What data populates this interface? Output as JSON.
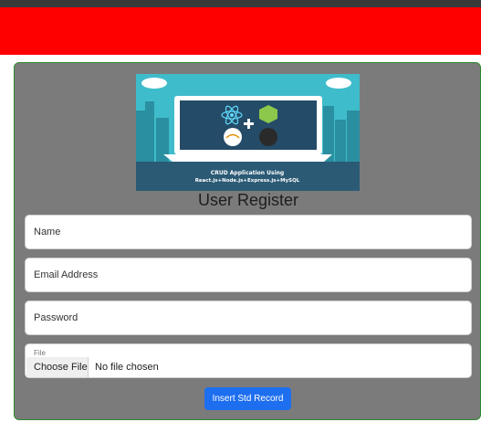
{
  "form": {
    "title": "User Register",
    "banner_caption_line1": "CRUD Application Using",
    "banner_caption_line2": "React.js+Node.js+Express.js+MySQL",
    "banner_logos": [
      "react-logo",
      "nodejs-logo",
      "mysql-logo",
      "express-logo"
    ],
    "name_placeholder": "Name",
    "email_placeholder": "Email Address",
    "password_placeholder": "Password",
    "file_label": "File",
    "file_button": "Choose File",
    "file_status": "No file chosen",
    "submit_label": "Insert Std Record"
  },
  "colors": {
    "header_red": "#ff0000",
    "card_bg": "#7b7b7b",
    "card_border": "#2e8b2e",
    "button_blue": "#1e6ff0"
  }
}
